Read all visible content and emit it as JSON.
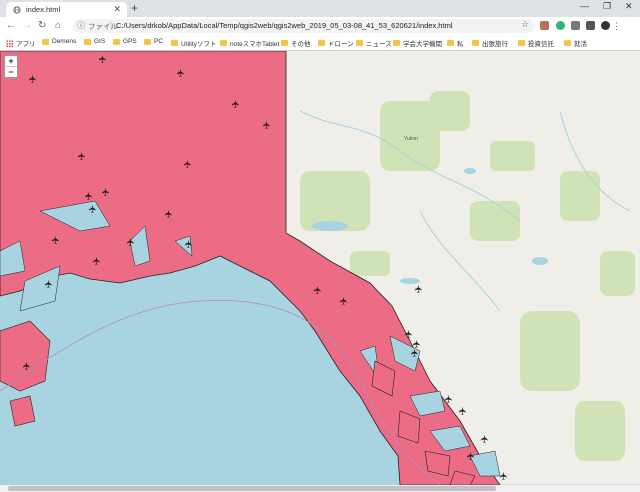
{
  "browser": {
    "tab_title": "index.html",
    "new_tab_label": "+",
    "url_scheme_label": "ファイル",
    "url_path": "C:/Users/drkob/AppData/Local/Temp/qgis2web/qgis2web_2019_05_03-08_41_53_620621/index.html"
  },
  "bookmarks": [
    {
      "label": "アプリ"
    },
    {
      "label": "Demens"
    },
    {
      "label": "GIS"
    },
    {
      "label": "GPS"
    },
    {
      "label": "PC"
    },
    {
      "label": "Utilityソフト"
    },
    {
      "label": "noteスマホTablet"
    },
    {
      "label": "その他"
    },
    {
      "label": "ドローン"
    },
    {
      "label": "ニュース"
    },
    {
      "label": "学会大学機関"
    },
    {
      "label": "私"
    },
    {
      "label": "出張旅行"
    },
    {
      "label": "投資信託"
    },
    {
      "label": "就活"
    }
  ],
  "map": {
    "zoom_in_label": "+",
    "zoom_out_label": "−",
    "place_label": "Yukon",
    "highlight_color": "#ec6c86",
    "water_color": "#a8d3e0",
    "land_color": "#f0eee8",
    "marker_icon": "airplane-icon",
    "marker_count": 38
  }
}
